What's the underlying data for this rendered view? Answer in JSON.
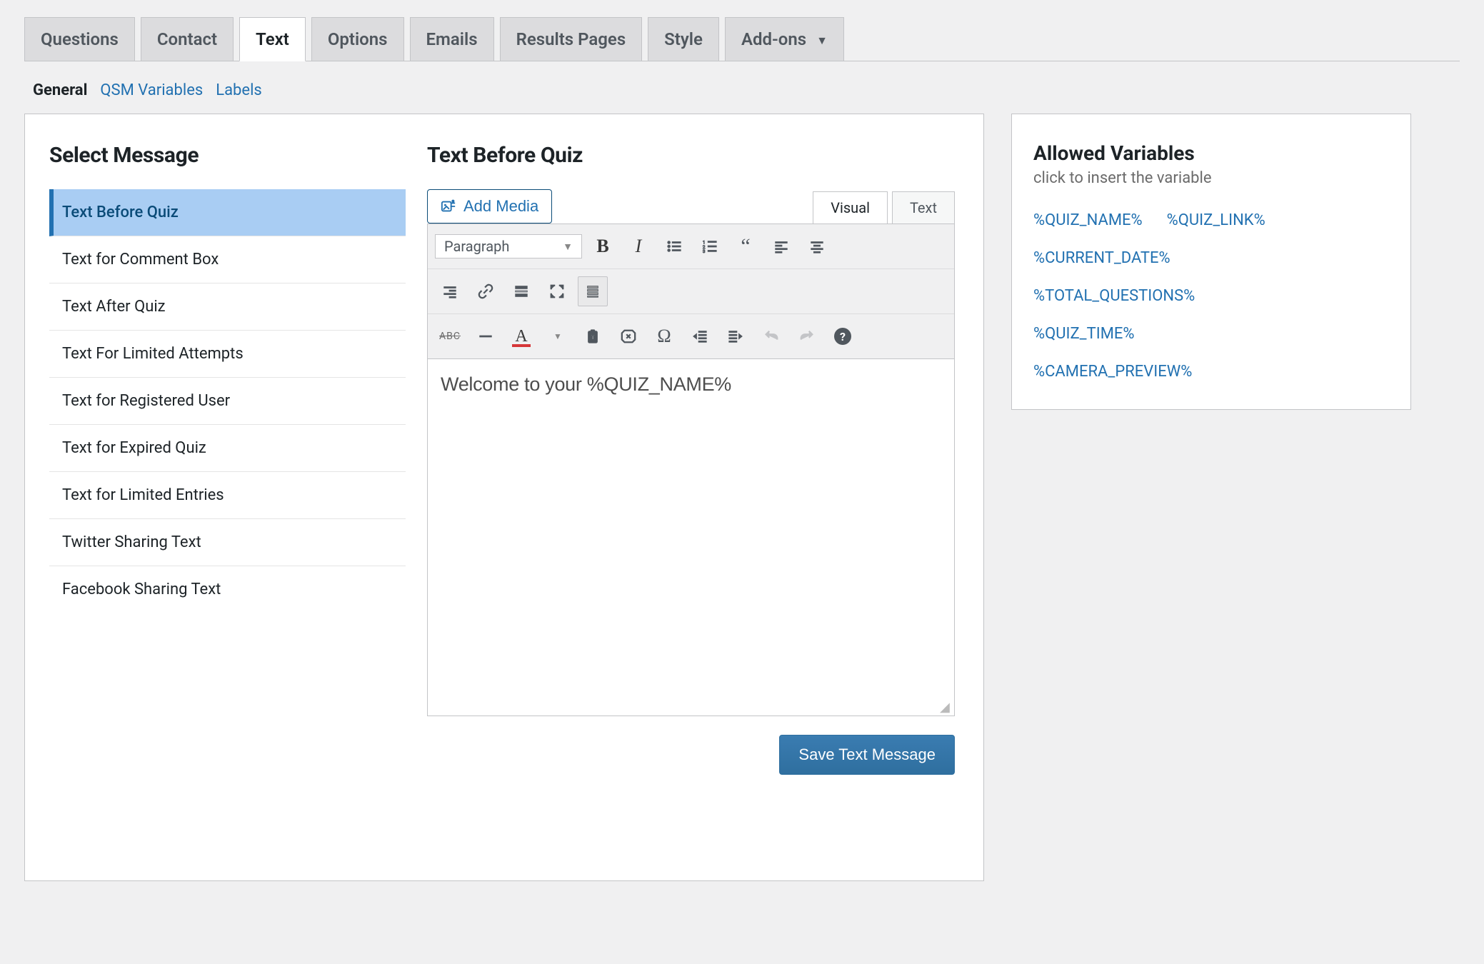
{
  "main_tabs": {
    "items": [
      {
        "label": "Questions"
      },
      {
        "label": "Contact"
      },
      {
        "label": "Text",
        "active": true
      },
      {
        "label": "Options"
      },
      {
        "label": "Emails"
      },
      {
        "label": "Results Pages"
      },
      {
        "label": "Style"
      },
      {
        "label": "Add-ons",
        "has_caret": true
      }
    ]
  },
  "sub_nav": {
    "items": [
      {
        "label": "General",
        "active": true
      },
      {
        "label": "QSM Variables"
      },
      {
        "label": "Labels"
      }
    ]
  },
  "left": {
    "title": "Select Message",
    "items": [
      {
        "label": "Text Before Quiz",
        "selected": true
      },
      {
        "label": "Text for Comment Box"
      },
      {
        "label": "Text After Quiz"
      },
      {
        "label": "Text For Limited Attempts"
      },
      {
        "label": "Text for Registered User"
      },
      {
        "label": "Text for Expired Quiz"
      },
      {
        "label": "Text for Limited Entries"
      },
      {
        "label": "Twitter Sharing Text"
      },
      {
        "label": "Facebook Sharing Text"
      }
    ]
  },
  "editor": {
    "title": "Text Before Quiz",
    "add_media_label": "Add Media",
    "modes": {
      "visual": "Visual",
      "text": "Text",
      "active": "visual"
    },
    "format_select": "Paragraph",
    "content": "Welcome to your %QUIZ_NAME%",
    "save_label": "Save Text Message"
  },
  "right": {
    "title": "Allowed Variables",
    "subtitle": "click to insert the variable",
    "vars": [
      "%QUIZ_NAME%",
      "%QUIZ_LINK%",
      "%CURRENT_DATE%",
      "%TOTAL_QUESTIONS%",
      "%QUIZ_TIME%",
      "%CAMERA_PREVIEW%"
    ]
  }
}
